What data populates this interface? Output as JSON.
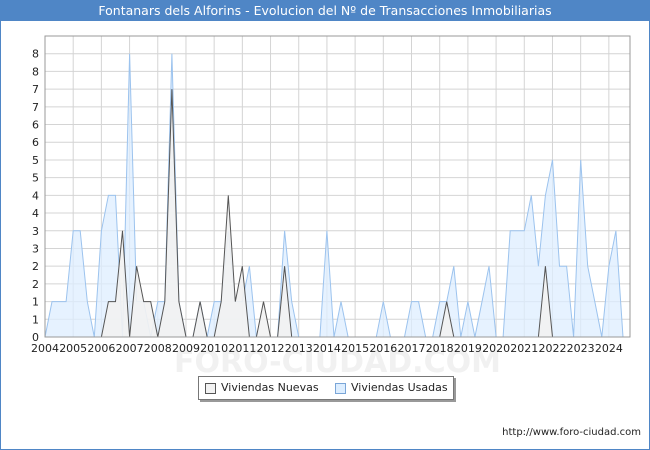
{
  "title": "Fontanars dels Alforins - Evolucion del Nº de Transacciones Inmobiliarias",
  "source": "http://www.foro-ciudad.com",
  "watermark": "FORO-CIUDAD.COM",
  "colors": {
    "accent": "#4f86c6",
    "nuevas_fill": "#f2f2f2",
    "nuevas_line": "#555555",
    "usadas_fill": "#ddeeff",
    "usadas_line": "#9cc3ee"
  },
  "chart_data": {
    "type": "area",
    "title": "Fontanars dels Alforins - Evolucion del Nº de Transacciones Inmobiliarias",
    "x_ticks": [
      "2004",
      "2005",
      "2006",
      "2007",
      "2008",
      "2009",
      "2010",
      "2011",
      "2012",
      "2013",
      "2014",
      "2015",
      "2016",
      "2017",
      "2018",
      "2019",
      "2020",
      "2021",
      "2022",
      "2023",
      "2024"
    ],
    "y_ticks": [
      "0",
      "1",
      "1",
      "2",
      "2",
      "3",
      "3",
      "4",
      "4",
      "5",
      "5",
      "6",
      "6",
      "7",
      "7",
      "8",
      "8"
    ],
    "xlim": [
      2004,
      2024.75
    ],
    "ylim": [
      0,
      8.5
    ],
    "grid": true,
    "legend_position": "bottom-center",
    "series": [
      {
        "name": "Viviendas Nuevas",
        "x": [
          2004,
          2004.25,
          2004.5,
          2004.75,
          2005,
          2005.25,
          2005.5,
          2005.75,
          2006,
          2006.25,
          2006.5,
          2006.75,
          2007,
          2007.25,
          2007.5,
          2007.75,
          2008,
          2008.25,
          2008.5,
          2008.75,
          2009,
          2009.25,
          2009.5,
          2009.75,
          2010,
          2010.25,
          2010.5,
          2010.75,
          2011,
          2011.25,
          2011.5,
          2011.75,
          2012,
          2012.25,
          2012.5,
          2012.75,
          2013,
          2013.25,
          2013.5,
          2013.75,
          2014,
          2014.25,
          2014.5,
          2014.75,
          2015,
          2015.25,
          2015.5,
          2015.75,
          2016,
          2016.25,
          2016.5,
          2016.75,
          2017,
          2017.25,
          2017.5,
          2017.75,
          2018,
          2018.25,
          2018.5,
          2018.75,
          2019,
          2019.25,
          2019.5,
          2019.75,
          2020,
          2020.25,
          2020.5,
          2020.75,
          2021,
          2021.25,
          2021.5,
          2021.75,
          2022,
          2022.25,
          2022.5,
          2022.75,
          2023,
          2023.25,
          2023.5,
          2023.75,
          2024,
          2024.25,
          2024.5,
          2024.75
        ],
        "values": [
          0,
          0,
          0,
          0,
          0,
          0,
          0,
          0,
          0,
          1,
          1,
          3,
          0,
          2,
          1,
          1,
          0,
          1,
          7,
          1,
          0,
          0,
          1,
          0,
          0,
          1,
          4,
          1,
          2,
          0,
          0,
          1,
          0,
          0,
          2,
          0,
          0,
          0,
          0,
          0,
          0,
          0,
          0,
          0,
          0,
          0,
          0,
          0,
          0,
          0,
          0,
          0,
          0,
          0,
          0,
          0,
          0,
          1,
          0,
          0,
          0,
          0,
          0,
          0,
          0,
          0,
          0,
          0,
          0,
          0,
          0,
          2,
          0,
          0,
          0,
          0,
          0,
          0,
          0,
          0,
          0,
          0,
          0,
          0
        ]
      },
      {
        "name": "Viviendas Usadas",
        "x": [
          2004,
          2004.25,
          2004.5,
          2004.75,
          2005,
          2005.25,
          2005.5,
          2005.75,
          2006,
          2006.25,
          2006.5,
          2006.75,
          2007,
          2007.25,
          2007.5,
          2007.75,
          2008,
          2008.25,
          2008.5,
          2008.75,
          2009,
          2009.25,
          2009.5,
          2009.75,
          2010,
          2010.25,
          2010.5,
          2010.75,
          2011,
          2011.25,
          2011.5,
          2011.75,
          2012,
          2012.25,
          2012.5,
          2012.75,
          2013,
          2013.25,
          2013.5,
          2013.75,
          2014,
          2014.25,
          2014.5,
          2014.75,
          2015,
          2015.25,
          2015.5,
          2015.75,
          2016,
          2016.25,
          2016.5,
          2016.75,
          2017,
          2017.25,
          2017.5,
          2017.75,
          2018,
          2018.25,
          2018.5,
          2018.75,
          2019,
          2019.25,
          2019.5,
          2019.75,
          2020,
          2020.25,
          2020.5,
          2020.75,
          2021,
          2021.25,
          2021.5,
          2021.75,
          2022,
          2022.25,
          2022.5,
          2022.75,
          2023,
          2023.25,
          2023.5,
          2023.75,
          2024,
          2024.25,
          2024.5,
          2024.75
        ],
        "values": [
          0,
          1,
          1,
          1,
          3,
          3,
          1,
          0,
          3,
          4,
          4,
          0,
          8,
          1,
          1,
          0,
          1,
          1,
          8,
          1,
          0,
          0,
          1,
          0,
          1,
          1,
          3,
          1,
          1,
          2,
          0,
          0,
          0,
          0,
          3,
          1,
          0,
          0,
          0,
          0,
          3,
          0,
          1,
          0,
          0,
          0,
          0,
          0,
          1,
          0,
          0,
          0,
          1,
          1,
          0,
          0,
          1,
          1,
          2,
          0,
          1,
          0,
          1,
          2,
          0,
          0,
          3,
          3,
          3,
          4,
          2,
          4,
          5,
          2,
          2,
          0,
          5,
          2,
          1,
          0,
          2,
          3,
          0,
          0
        ]
      }
    ]
  }
}
